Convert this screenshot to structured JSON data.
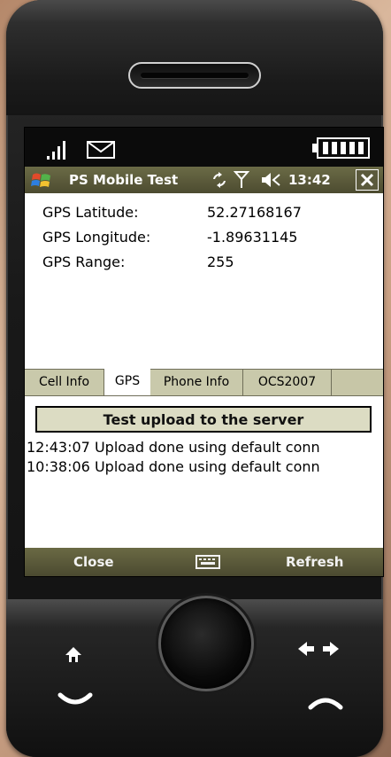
{
  "app": {
    "title": "PS Mobile Test",
    "time": "13:42"
  },
  "status_icons": [
    "signal-icon",
    "mail-icon",
    "battery-icon",
    "start-icon",
    "sync-icon",
    "antenna-icon",
    "volume-icon",
    "close-icon",
    "keyboard-icon",
    "home-icon",
    "back-forward-icon",
    "call-icon",
    "end-call-icon"
  ],
  "gps": {
    "fields": [
      {
        "label": "GPS Latitude:",
        "value": "52.27168167"
      },
      {
        "label": "GPS Longitude:",
        "value": "-1.89631145"
      },
      {
        "label": "GPS Range:",
        "value": "255"
      }
    ]
  },
  "tabs": [
    {
      "label": "Cell Info",
      "active": false
    },
    {
      "label": "GPS",
      "active": true
    },
    {
      "label": "Phone Info",
      "active": false
    },
    {
      "label": "OCS2007",
      "active": false
    }
  ],
  "actions": {
    "upload_label": "Test upload to the server"
  },
  "log": [
    "12:43:07 Upload done using default conn",
    "10:38:06 Upload done using default conn"
  ],
  "softkeys": {
    "left": "Close",
    "right": "Refresh"
  },
  "colors": {
    "title_bar": "#5b5a3c",
    "tab_bar": "#c7c6a7",
    "screen_bg": "#ffffff",
    "status_bar": "#0b0b0b"
  }
}
